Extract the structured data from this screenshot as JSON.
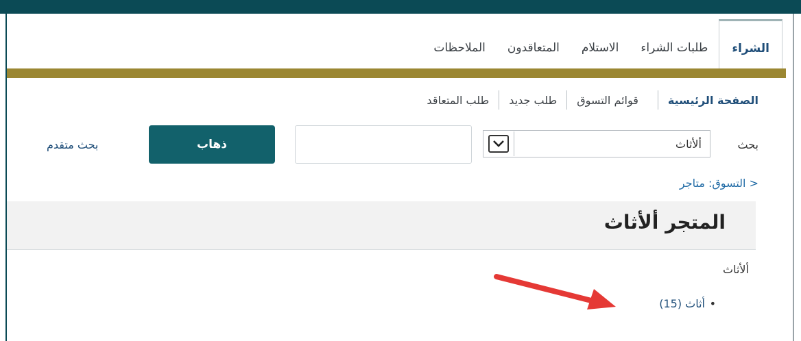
{
  "tabs": [
    {
      "label": "الشراء",
      "active": true
    },
    {
      "label": "طلبات الشراء"
    },
    {
      "label": "الاستلام"
    },
    {
      "label": "المتعاقدون"
    },
    {
      "label": "الملاحظات"
    }
  ],
  "subnav": {
    "home": "الصفحة الرئيسية",
    "shopping_lists": "قوائم التسوق",
    "new_request": "طلب جديد",
    "contractor_request": "طلب المتعاقد"
  },
  "search": {
    "label": "بحث",
    "category_value": "ألأثاث",
    "go_button": "ذهاب",
    "advanced_link": "بحث متقدم"
  },
  "breadcrumb": "التسوق: متاجر >",
  "store_title": "المتجر ألأثاث",
  "category_heading": "ألأثاث",
  "category_item": "أثاث (15)",
  "colors": {
    "header": "#0b4a55",
    "accent_bar": "#9b8732",
    "button": "#12616b",
    "link": "#1f4e79",
    "arrow": "#e53935"
  }
}
